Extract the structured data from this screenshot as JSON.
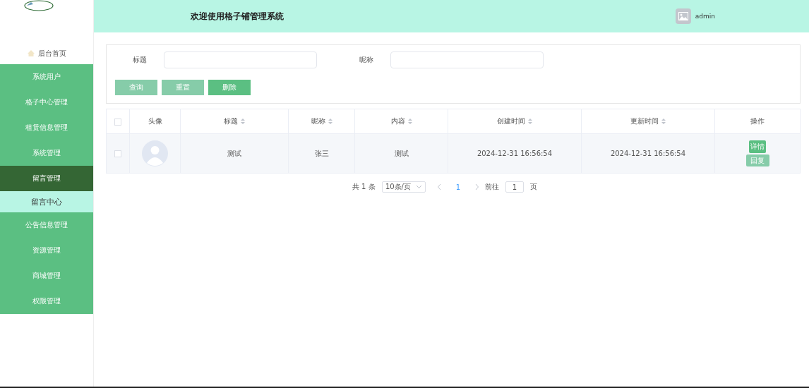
{
  "header": {
    "title": "欢迎使用格子铺管理系统",
    "user": "admin"
  },
  "sidebar": {
    "items": [
      {
        "kind": "home",
        "label": "后台首页",
        "selected": false
      },
      {
        "kind": "menu",
        "label": "系统用户",
        "selected": false
      },
      {
        "kind": "menu",
        "label": "格子中心管理",
        "selected": false
      },
      {
        "kind": "menu",
        "label": "租赁信息管理",
        "selected": false
      },
      {
        "kind": "menu",
        "label": "系统管理",
        "selected": false
      },
      {
        "kind": "menu",
        "label": "留言管理",
        "selected": true,
        "children": [
          {
            "label": "留言中心",
            "selected": true
          }
        ]
      },
      {
        "kind": "menu",
        "label": "公告信息管理",
        "selected": false
      },
      {
        "kind": "menu",
        "label": "资源管理",
        "selected": false
      },
      {
        "kind": "menu",
        "label": "商城管理",
        "selected": false
      },
      {
        "kind": "menu",
        "label": "权限管理",
        "selected": false
      }
    ]
  },
  "search": {
    "fields": [
      {
        "label": "标题"
      },
      {
        "label": "昵称"
      }
    ],
    "buttons": [
      {
        "label": "查询",
        "kind": "light"
      },
      {
        "label": "重置",
        "kind": "light"
      },
      {
        "label": "删除",
        "kind": "solid"
      }
    ]
  },
  "table": {
    "all_checked": false,
    "columns": [
      {
        "label": "头像",
        "kind": "avatar",
        "sortable": false
      },
      {
        "label": "标题",
        "kind": "text",
        "sortable": true
      },
      {
        "label": "昵称",
        "kind": "text",
        "sortable": true
      },
      {
        "label": "内容",
        "kind": "text",
        "sortable": true
      },
      {
        "label": "创建时间",
        "kind": "text",
        "sortable": true
      },
      {
        "label": "更新时间",
        "kind": "text",
        "sortable": true
      },
      {
        "label": "操作",
        "kind": "actions",
        "sortable": false
      }
    ],
    "rows": [
      {
        "checked": false,
        "cells": [
          "",
          "测试",
          "张三",
          "测试",
          "2024-12-31 16:56:54",
          "2024-12-31 16:56:54"
        ],
        "actions": [
          {
            "label": "详情",
            "kind": "solid"
          },
          {
            "label": "回复",
            "kind": "light"
          }
        ]
      }
    ]
  },
  "pagination": {
    "total": "共 1 条",
    "page_size": "10条/页",
    "current": "1",
    "goto_label": "前往",
    "goto_value": "1",
    "page_unit": "页"
  }
}
